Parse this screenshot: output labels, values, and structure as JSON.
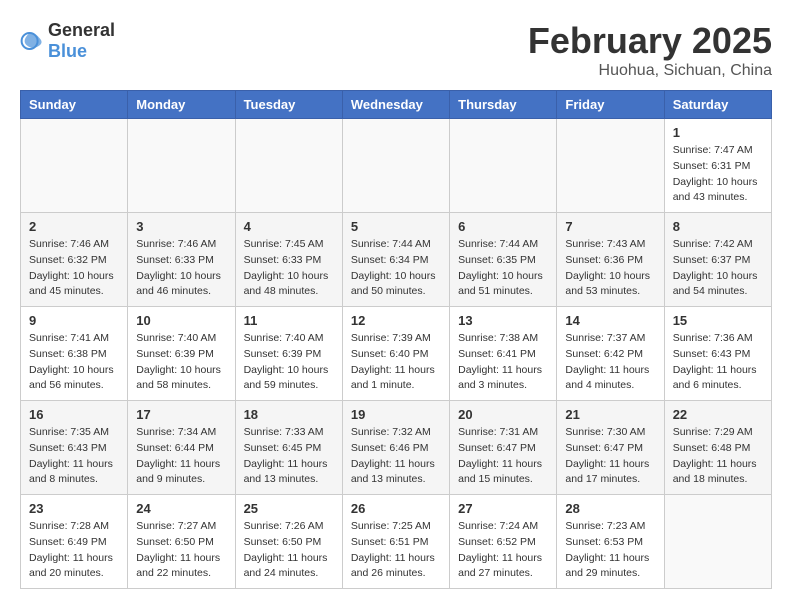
{
  "header": {
    "logo": {
      "general": "General",
      "blue": "Blue"
    },
    "title": "February 2025",
    "location": "Huohua, Sichuan, China"
  },
  "weekdays": [
    "Sunday",
    "Monday",
    "Tuesday",
    "Wednesday",
    "Thursday",
    "Friday",
    "Saturday"
  ],
  "weeks": [
    [
      {
        "day": "",
        "info": ""
      },
      {
        "day": "",
        "info": ""
      },
      {
        "day": "",
        "info": ""
      },
      {
        "day": "",
        "info": ""
      },
      {
        "day": "",
        "info": ""
      },
      {
        "day": "",
        "info": ""
      },
      {
        "day": "1",
        "info": "Sunrise: 7:47 AM\nSunset: 6:31 PM\nDaylight: 10 hours and 43 minutes."
      }
    ],
    [
      {
        "day": "2",
        "info": "Sunrise: 7:46 AM\nSunset: 6:32 PM\nDaylight: 10 hours and 45 minutes."
      },
      {
        "day": "3",
        "info": "Sunrise: 7:46 AM\nSunset: 6:33 PM\nDaylight: 10 hours and 46 minutes."
      },
      {
        "day": "4",
        "info": "Sunrise: 7:45 AM\nSunset: 6:33 PM\nDaylight: 10 hours and 48 minutes."
      },
      {
        "day": "5",
        "info": "Sunrise: 7:44 AM\nSunset: 6:34 PM\nDaylight: 10 hours and 50 minutes."
      },
      {
        "day": "6",
        "info": "Sunrise: 7:44 AM\nSunset: 6:35 PM\nDaylight: 10 hours and 51 minutes."
      },
      {
        "day": "7",
        "info": "Sunrise: 7:43 AM\nSunset: 6:36 PM\nDaylight: 10 hours and 53 minutes."
      },
      {
        "day": "8",
        "info": "Sunrise: 7:42 AM\nSunset: 6:37 PM\nDaylight: 10 hours and 54 minutes."
      }
    ],
    [
      {
        "day": "9",
        "info": "Sunrise: 7:41 AM\nSunset: 6:38 PM\nDaylight: 10 hours and 56 minutes."
      },
      {
        "day": "10",
        "info": "Sunrise: 7:40 AM\nSunset: 6:39 PM\nDaylight: 10 hours and 58 minutes."
      },
      {
        "day": "11",
        "info": "Sunrise: 7:40 AM\nSunset: 6:39 PM\nDaylight: 10 hours and 59 minutes."
      },
      {
        "day": "12",
        "info": "Sunrise: 7:39 AM\nSunset: 6:40 PM\nDaylight: 11 hours and 1 minute."
      },
      {
        "day": "13",
        "info": "Sunrise: 7:38 AM\nSunset: 6:41 PM\nDaylight: 11 hours and 3 minutes."
      },
      {
        "day": "14",
        "info": "Sunrise: 7:37 AM\nSunset: 6:42 PM\nDaylight: 11 hours and 4 minutes."
      },
      {
        "day": "15",
        "info": "Sunrise: 7:36 AM\nSunset: 6:43 PM\nDaylight: 11 hours and 6 minutes."
      }
    ],
    [
      {
        "day": "16",
        "info": "Sunrise: 7:35 AM\nSunset: 6:43 PM\nDaylight: 11 hours and 8 minutes."
      },
      {
        "day": "17",
        "info": "Sunrise: 7:34 AM\nSunset: 6:44 PM\nDaylight: 11 hours and 9 minutes."
      },
      {
        "day": "18",
        "info": "Sunrise: 7:33 AM\nSunset: 6:45 PM\nDaylight: 11 hours and 13 minutes."
      },
      {
        "day": "19",
        "info": "Sunrise: 7:32 AM\nSunset: 6:46 PM\nDaylight: 11 hours and 13 minutes."
      },
      {
        "day": "20",
        "info": "Sunrise: 7:31 AM\nSunset: 6:47 PM\nDaylight: 11 hours and 15 minutes."
      },
      {
        "day": "21",
        "info": "Sunrise: 7:30 AM\nSunset: 6:47 PM\nDaylight: 11 hours and 17 minutes."
      },
      {
        "day": "22",
        "info": "Sunrise: 7:29 AM\nSunset: 6:48 PM\nDaylight: 11 hours and 18 minutes."
      }
    ],
    [
      {
        "day": "23",
        "info": "Sunrise: 7:28 AM\nSunset: 6:49 PM\nDaylight: 11 hours and 20 minutes."
      },
      {
        "day": "24",
        "info": "Sunrise: 7:27 AM\nSunset: 6:50 PM\nDaylight: 11 hours and 22 minutes."
      },
      {
        "day": "25",
        "info": "Sunrise: 7:26 AM\nSunset: 6:50 PM\nDaylight: 11 hours and 24 minutes."
      },
      {
        "day": "26",
        "info": "Sunrise: 7:25 AM\nSunset: 6:51 PM\nDaylight: 11 hours and 26 minutes."
      },
      {
        "day": "27",
        "info": "Sunrise: 7:24 AM\nSunset: 6:52 PM\nDaylight: 11 hours and 27 minutes."
      },
      {
        "day": "28",
        "info": "Sunrise: 7:23 AM\nSunset: 6:53 PM\nDaylight: 11 hours and 29 minutes."
      },
      {
        "day": "",
        "info": ""
      }
    ]
  ]
}
